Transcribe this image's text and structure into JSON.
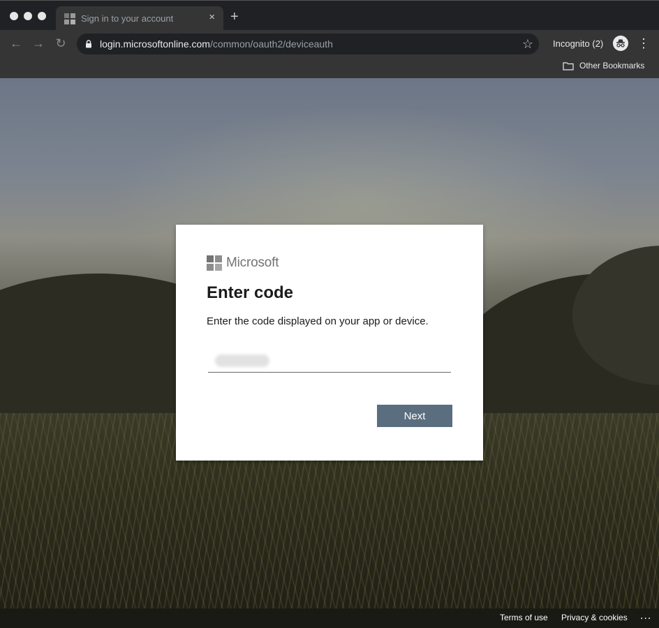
{
  "browser": {
    "tab_title": "Sign in to your account",
    "tab_close": "×",
    "new_tab": "+",
    "url_host": "login.microsoftonline.com",
    "url_path": "/common/oauth2/deviceauth",
    "incognito_label": "Incognito (2)",
    "bookmark_label": "Other Bookmarks",
    "icons": {
      "back": "←",
      "forward": "→",
      "reload": "↻",
      "star": "☆",
      "menu": "⋮"
    }
  },
  "card": {
    "brand": "Microsoft",
    "title": "Enter code",
    "description": "Enter the code displayed on your app or device.",
    "code_value": "",
    "next_label": "Next"
  },
  "footer": {
    "terms": "Terms of use",
    "privacy": "Privacy & cookies",
    "more": "..."
  },
  "colors": {
    "next_button": "#5a6e80",
    "card_bg": "#ffffff",
    "chrome_bg": "#353535"
  }
}
